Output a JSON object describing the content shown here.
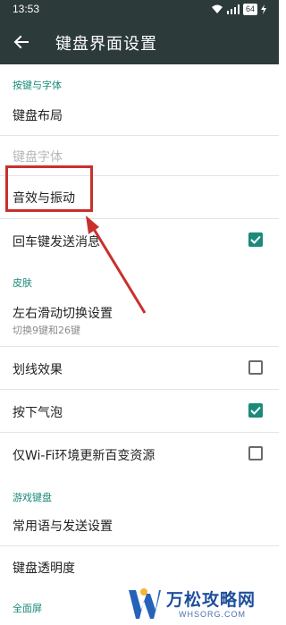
{
  "status_bar": {
    "time": "13:53",
    "battery": "64"
  },
  "app_bar": {
    "back_icon": "arrow-left-icon",
    "title": "键盘界面设置"
  },
  "sections": {
    "keys_fonts": "按键与字体",
    "skin": "皮肤",
    "game_keyboard": "游戏键盘",
    "fullscreen": "全面屏"
  },
  "items": {
    "keyboard_layout": "键盘布局",
    "keyboard_font": "键盘字体",
    "sound_vibration": "音效与振动",
    "enter_send": "回车键发送消息",
    "swipe_switch": "左右滑动切换设置",
    "swipe_switch_sub": "切换9键和26键",
    "line_effect": "划线效果",
    "press_bubble": "按下气泡",
    "wifi_update": "仅Wi-Fi环境更新百变资源",
    "common_phrases": "常用语与发送设置",
    "keyboard_transparency": "键盘透明度"
  },
  "toggles": {
    "enter_send": true,
    "line_effect": false,
    "press_bubble": true,
    "wifi_update": false
  },
  "colors": {
    "header": "#2d3a3a",
    "accent": "#1a8a7a",
    "highlight": "#c9302c"
  },
  "watermark": {
    "brand": "万松攻略网",
    "domain": "WHSORG.COM"
  }
}
